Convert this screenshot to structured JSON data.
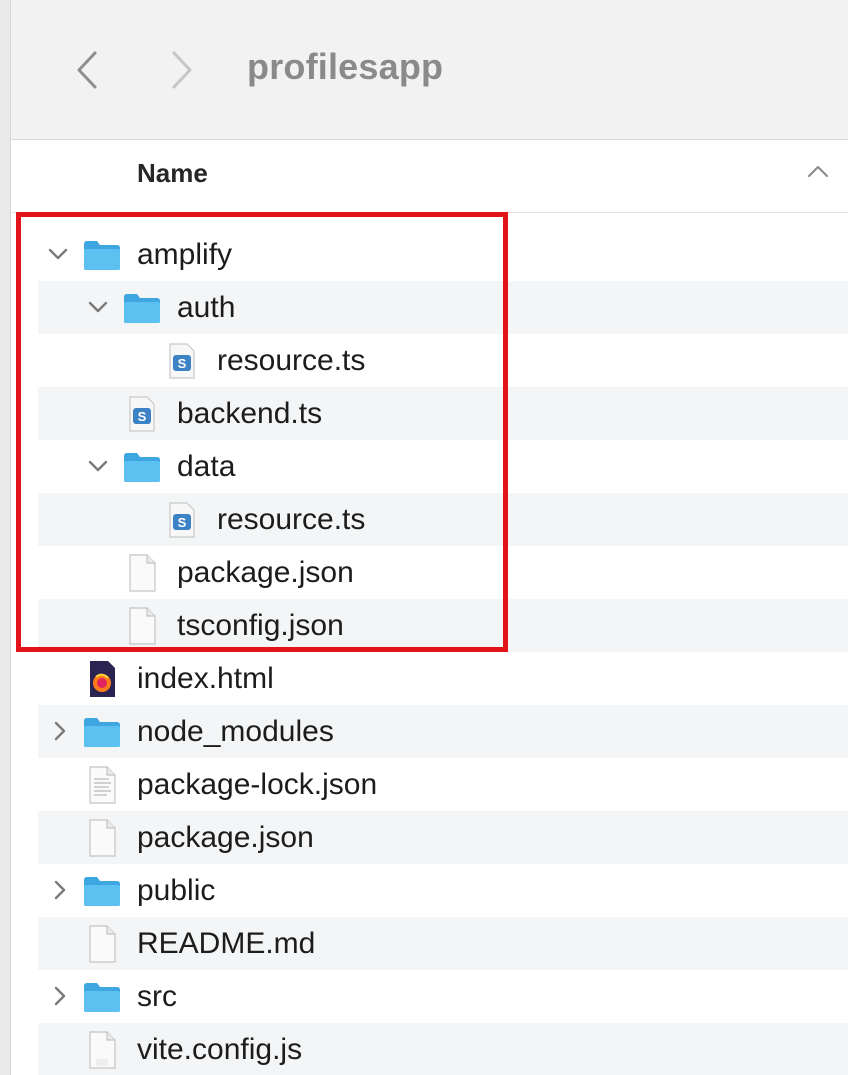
{
  "toolbar": {
    "title": "profilesapp",
    "back_icon": "chevron-left-icon",
    "forward_icon": "chevron-right-icon"
  },
  "header": {
    "name_column": "Name",
    "sort_icon": "chevron-up-icon"
  },
  "colors": {
    "folder": "#4fb3e8",
    "highlight": "#e2141a",
    "alt_row": "#f3f5f6"
  },
  "files": [
    {
      "label": "amplify",
      "icon": "folder-icon",
      "expanded": true
    },
    {
      "label": "auth",
      "icon": "folder-icon",
      "expanded": true
    },
    {
      "label": "resource.ts",
      "icon": "typescript-file-icon"
    },
    {
      "label": "backend.ts",
      "icon": "typescript-file-icon"
    },
    {
      "label": "data",
      "icon": "folder-icon",
      "expanded": true
    },
    {
      "label": "resource.ts",
      "icon": "typescript-file-icon"
    },
    {
      "label": "package.json",
      "icon": "document-icon"
    },
    {
      "label": "tsconfig.json",
      "icon": "document-icon"
    },
    {
      "label": "index.html",
      "icon": "html-file-icon"
    },
    {
      "label": "node_modules",
      "icon": "folder-icon",
      "expanded": false
    },
    {
      "label": "package-lock.json",
      "icon": "text-document-icon"
    },
    {
      "label": "package.json",
      "icon": "document-icon"
    },
    {
      "label": "public",
      "icon": "folder-icon",
      "expanded": false
    },
    {
      "label": "README.md",
      "icon": "document-icon"
    },
    {
      "label": "src",
      "icon": "folder-icon",
      "expanded": false
    },
    {
      "label": "vite.config.js",
      "icon": "js-file-icon"
    }
  ]
}
